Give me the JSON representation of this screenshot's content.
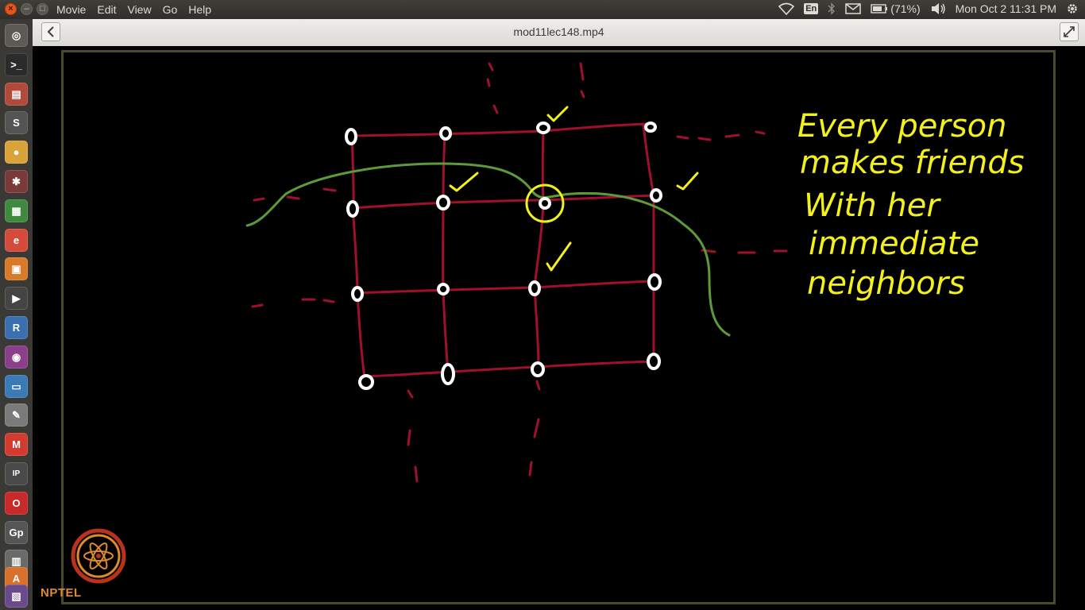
{
  "menubar": {
    "menus": [
      "Movie",
      "Edit",
      "View",
      "Go",
      "Help"
    ],
    "keyboard_indicator": "En",
    "battery": "(71%)",
    "clock": "Mon Oct  2 11:31 PM"
  },
  "window": {
    "title": "mod11lec148.mp4"
  },
  "video": {
    "annotation_lines": [
      "Every person",
      "makes friends",
      "With her",
      "immediate",
      "neighbors"
    ],
    "logo_text": "NPTEL",
    "colors": {
      "grid": "#a0102a",
      "nodes": "#ffffff",
      "text": "#f3f01c",
      "curve": "#5e9a3a",
      "background": "#000000"
    }
  },
  "launcher": {
    "icons": [
      "dash-home-icon",
      "terminal-icon",
      "files-icon",
      "sublime-text-icon",
      "chrome-icon",
      "settings-icon",
      "spreadsheet-icon",
      "document-viewer-icon",
      "presentation-icon",
      "video-player-icon",
      "r-icon",
      "screen-recorder-icon",
      "document-icon",
      "text-editor-icon",
      "gmail-icon",
      "ipython-icon",
      "opera-icon",
      "gp-icon",
      "workspace-icon",
      "software-center-icon",
      "trash-icon"
    ]
  }
}
